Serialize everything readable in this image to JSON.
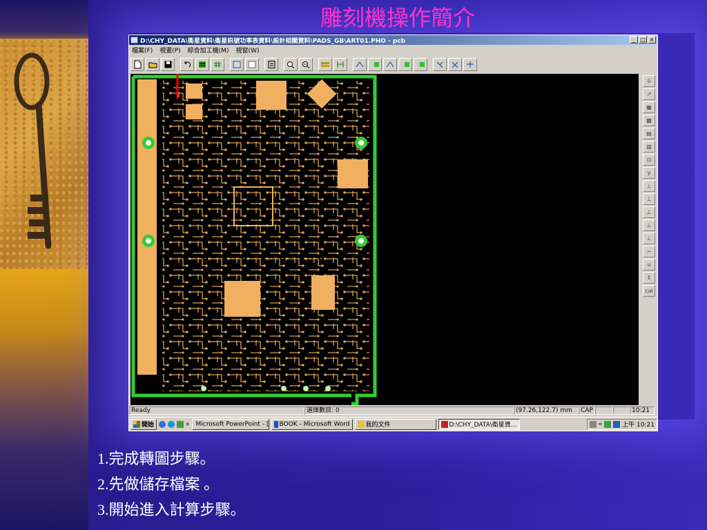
{
  "slide": {
    "title": "雕刻機操作簡介",
    "bullets": [
      "1.完成轉圖步驟。",
      "2.先做儲存檔案 。",
      "3.開始進入計算步驟。"
    ]
  },
  "window": {
    "title": "D:\\CHY_DATA\\衛星資料\\衛星訊號功率表資料\\設計相關資料\\PADS_GB\\ART01.PHO - pcb",
    "buttons": [
      "_",
      "□",
      "×"
    ],
    "menu": [
      "檔案(F)",
      "視畫(P)",
      "綜合加工機(M)",
      "視窗(W)"
    ]
  },
  "toolbar_icons": [
    "new-file-icon",
    "open-folder-icon",
    "save-icon",
    "undo-icon",
    "layer-green-icon",
    "grid-icon",
    "rect-select-icon",
    "window-icon",
    "calculator-icon",
    "zoom-icon",
    "zoom-out-icon",
    "drill-icon",
    "measure-icon",
    "route1-icon",
    "route2-icon",
    "route3-icon",
    "route4-icon",
    "route5-icon",
    "probe-icon",
    "cut-icon",
    "mill-icon"
  ],
  "right_tools": [
    "①",
    "↗",
    "▦",
    "▩",
    "▤",
    "▧",
    "⊡",
    "y",
    "⊥",
    "⊥",
    "⊥",
    "⊥",
    "⊥",
    "∽",
    "⊍",
    "⇕",
    "cal"
  ],
  "statusbar": {
    "ready": "Ready",
    "selected": "選擇數目: 0",
    "coords": "(97.26,122.7) mm",
    "cap": "CAP",
    "time": "10:21"
  },
  "taskbar": {
    "start": "開始",
    "tasks": [
      "Microsoft PowerPoint - [...",
      "BOOK - Microsoft Word",
      "我的文件",
      "D:\\CHY_DATA\\衛星資..."
    ],
    "clock": "上午 10:21",
    "chevron": "»",
    "tray_chevron": "«"
  },
  "colors": {
    "slide_bg": "#2e1fa0",
    "title": "#ff33cc",
    "pcb_copper": "#f0b060",
    "pcb_border": "#33cc33",
    "arrow": "#ff0000"
  }
}
